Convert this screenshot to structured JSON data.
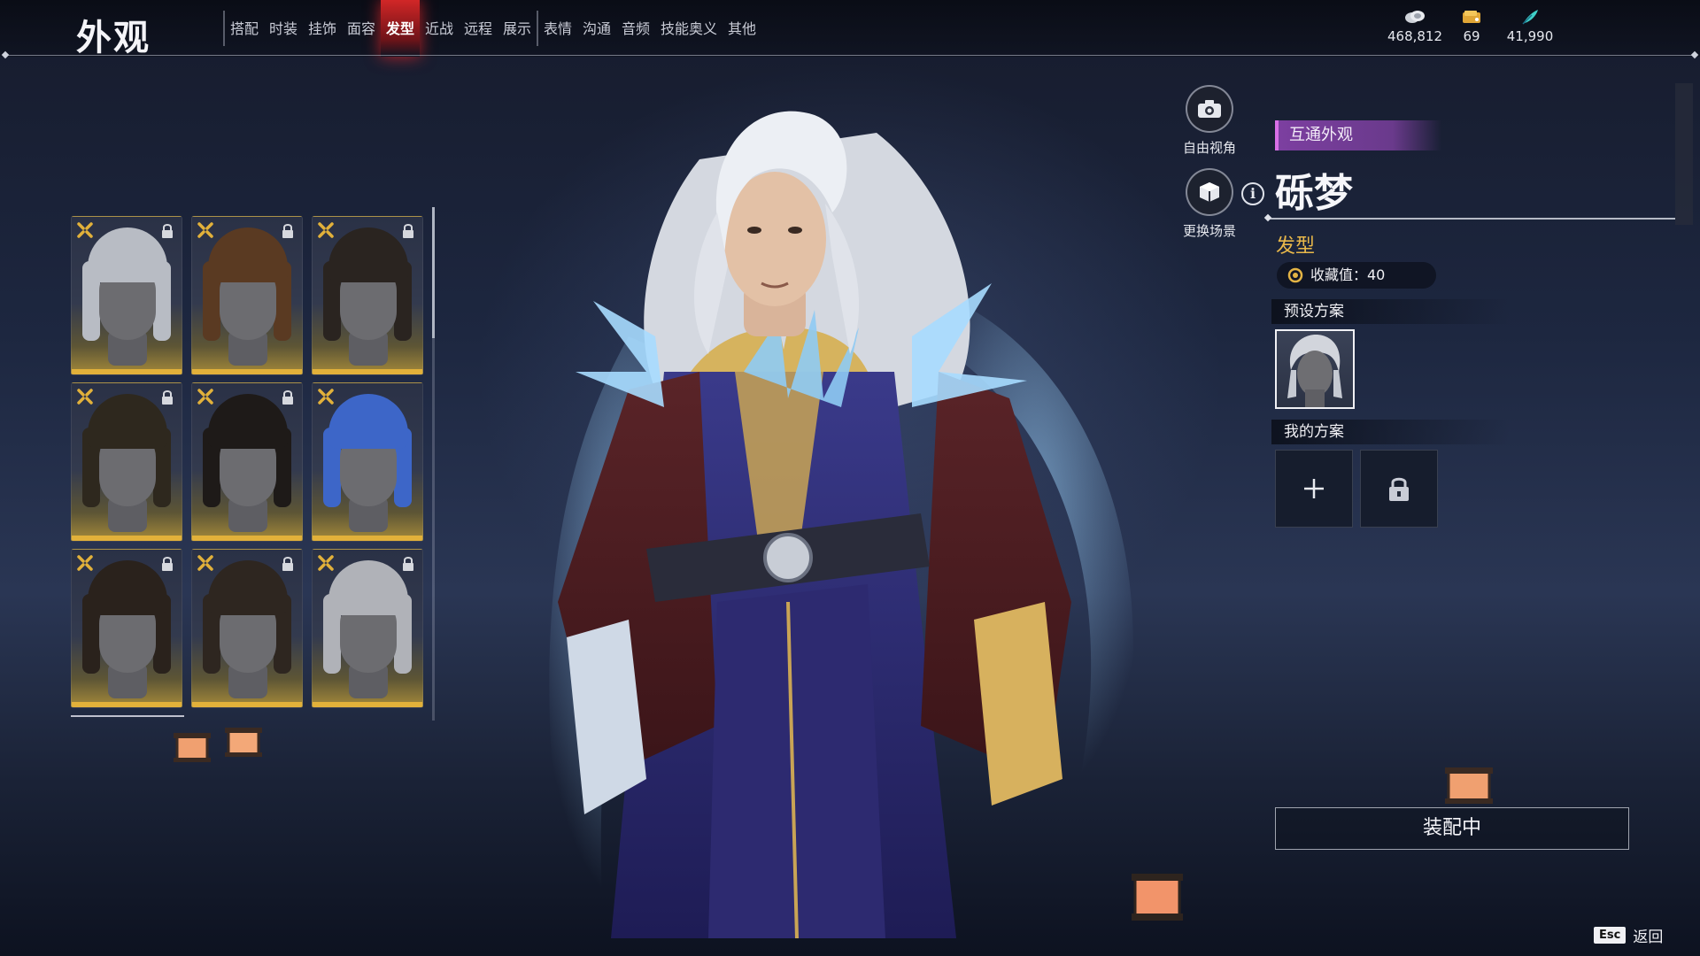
{
  "header": {
    "title": "外观",
    "tabs": [
      {
        "label": "搭配",
        "active": false
      },
      {
        "label": "时装",
        "active": false
      },
      {
        "label": "挂饰",
        "active": false
      },
      {
        "label": "面容",
        "active": false
      },
      {
        "label": "发型",
        "active": true
      },
      {
        "label": "近战",
        "active": false
      },
      {
        "label": "远程",
        "active": false
      },
      {
        "label": "展示",
        "active": false
      },
      {
        "label": "表情",
        "active": false
      },
      {
        "label": "沟通",
        "active": false
      },
      {
        "label": "音频",
        "active": false
      },
      {
        "label": "技能奥义",
        "active": false
      },
      {
        "label": "其他",
        "active": false
      }
    ],
    "currencies": [
      {
        "icon": "coin-stack-icon",
        "value": "468,812"
      },
      {
        "icon": "ticket-icon",
        "value": "69"
      },
      {
        "icon": "feather-icon",
        "value": "41,990"
      }
    ],
    "active_color": "#d42a2a"
  },
  "hair_grid": {
    "items": [
      {
        "name": "hairstyle-1",
        "hair_color": "#b8bcc4",
        "locked": true
      },
      {
        "name": "hairstyle-2",
        "hair_color": "#5a3a22",
        "locked": true
      },
      {
        "name": "hairstyle-3",
        "hair_color": "#2a2420",
        "locked": true
      },
      {
        "name": "hairstyle-4",
        "hair_color": "#2e281e",
        "locked": true
      },
      {
        "name": "hairstyle-5",
        "hair_color": "#1e1a18",
        "locked": true
      },
      {
        "name": "hairstyle-6",
        "hair_color": "#3d66c8",
        "locked": false
      },
      {
        "name": "hairstyle-7",
        "hair_color": "#2a221c",
        "locked": true
      },
      {
        "name": "hairstyle-8",
        "hair_color": "#2e2620",
        "locked": true
      },
      {
        "name": "hairstyle-9",
        "hair_color": "#b0b2b8",
        "locked": true
      }
    ],
    "accent_color": "#e2b13a"
  },
  "camera_controls": {
    "free_view": "自由视角",
    "change_scene": "更换场景"
  },
  "detail": {
    "tag": "互通外观",
    "name": "砾梦",
    "category": "发型",
    "collection_label": "收藏值：40",
    "preset_section": "预设方案",
    "my_section": "我的方案",
    "equip_label": "装配中"
  },
  "footer": {
    "esc_key": "Esc",
    "back_label": "返回"
  }
}
